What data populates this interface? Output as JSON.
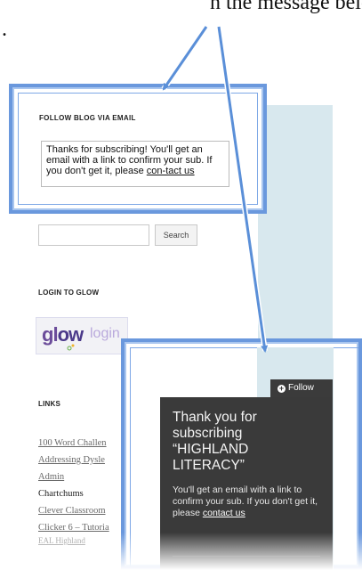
{
  "caption": {
    "line1": "n the message below. Please lo",
    "line2": "."
  },
  "follow_email_widget": {
    "title": "FOLLOW BLOG VIA EMAIL",
    "message": "Thanks for subscribing! You'll get an email with a link to confirm your sub. If you don't get it, please ",
    "link_text": "con-tact us"
  },
  "search": {
    "placeholder": "",
    "button_label": "Search"
  },
  "login_section": {
    "title": "LOGIN TO GLOW",
    "glow_text_a": "gl",
    "glow_text_b": "ow",
    "login_text": "login"
  },
  "links_section": {
    "title": "LINKS",
    "items": [
      {
        "label": "100 Word Challen",
        "style": "link"
      },
      {
        "label": "Addressing Dysle",
        "style": "link"
      },
      {
        "label": "Admin",
        "style": "link"
      },
      {
        "label": "Chartchums",
        "style": "plain"
      },
      {
        "label": "Clever Classroom",
        "style": "link"
      },
      {
        "label": "Clicker 6 – Tutoria",
        "style": "link"
      },
      {
        "label": "EAL Highland",
        "style": "cut"
      }
    ]
  },
  "follow_popup": {
    "button_label": "Follow",
    "heading": "Thank you for subscribing “HIGHLAND LITERACY”",
    "body": "You'll get an email with a link to confirm your sub. If you don't get it, please ",
    "link_text": "contact us"
  },
  "colors": {
    "callout_border": "#6a98dd",
    "popup_bg": "#3a3a3a",
    "sidebar_strip": "#d8e8ee"
  }
}
